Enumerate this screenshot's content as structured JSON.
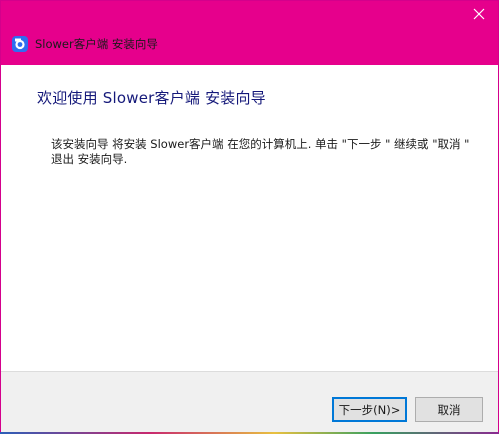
{
  "window": {
    "title": "Slower客户端 安装向导",
    "close_glyph": "✕",
    "app_icon": "slower-app-icon"
  },
  "content": {
    "heading": "欢迎使用 Slower客户端 安装向导",
    "description": "该安装向导 将安装 Slower客户端 在您的计算机上. 单击 \"下一步 \" 继续或 \"取消 \" 退出 安装向导."
  },
  "buttons": {
    "next_label": "下一步(N)>",
    "cancel_label": "取消"
  },
  "colors": {
    "titlebar": "#e6008c",
    "heading_text": "#15197a",
    "focus_border": "#0078d7"
  }
}
